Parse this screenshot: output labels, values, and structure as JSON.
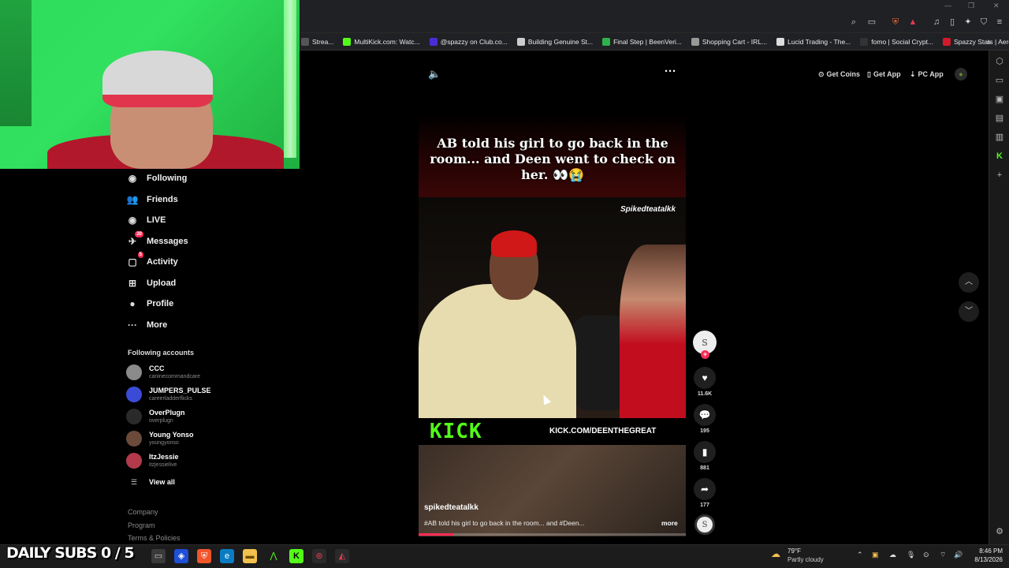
{
  "browser": {
    "bookmarks": [
      {
        "label": "Strea...",
        "icon": "stream-favicon",
        "color": "#555555"
      },
      {
        "label": "MultiKick.com: Watc...",
        "icon": "kick-favicon",
        "color": "#53fc18"
      },
      {
        "label": "@spazzy on Club.co...",
        "icon": "club-favicon",
        "color": "#4b2bd6"
      },
      {
        "label": "Building Genuine St...",
        "icon": "doc-favicon",
        "color": "#cccccc"
      },
      {
        "label": "Final Step | BeenVeri...",
        "icon": "beenverified-favicon",
        "color": "#2fb14b"
      },
      {
        "label": "Shopping Cart - IRL...",
        "icon": "globe-favicon",
        "color": "#999999"
      },
      {
        "label": "Lucid Trading - The...",
        "icon": "lucid-favicon",
        "color": "#dddddd"
      },
      {
        "label": "fomo | Social Crypt...",
        "icon": "fomo-favicon",
        "color": "#333333"
      },
      {
        "label": "Spazzy Stats | AeroK...",
        "icon": "aerok-favicon",
        "color": "#d11a2a"
      }
    ],
    "more_bookmarks": "»"
  },
  "sidebar": {
    "nav": [
      {
        "label": "Following",
        "icon": "following-avatar-icon"
      },
      {
        "label": "Friends",
        "icon": "friends-icon"
      },
      {
        "label": "LIVE",
        "icon": "live-icon"
      },
      {
        "label": "Messages",
        "icon": "messages-icon",
        "badge": "20"
      },
      {
        "label": "Activity",
        "icon": "activity-icon",
        "badge": "5"
      },
      {
        "label": "Upload",
        "icon": "upload-icon"
      },
      {
        "label": "Profile",
        "icon": "profile-avatar-icon"
      },
      {
        "label": "More",
        "icon": "more-dots-icon"
      }
    ],
    "following_title": "Following accounts",
    "accounts": [
      {
        "name": "CCC",
        "handle": "caninecommandcare"
      },
      {
        "name": "JUMPERS_PULSE",
        "handle": "careerladderflicks"
      },
      {
        "name": "OverPlugn",
        "handle": "overplugn"
      },
      {
        "name": "Young Yonso",
        "handle": "youngyonso"
      },
      {
        "name": "ItzJessie",
        "handle": "itzjessielive"
      }
    ],
    "view_all": "View all",
    "footer": [
      "Company",
      "Program",
      "Terms & Policies"
    ]
  },
  "topbar": {
    "get_coins": "Get Coins",
    "get_app": "Get App",
    "pc_app": "PC App"
  },
  "video": {
    "caption": "AB told his girl to go back in the room... and Deen went to check on her. 👀😭",
    "watermark": "Spikedteatalkk",
    "kick_logo": "KICK",
    "kick_url": "KICK.COM/DEENTHEGREAT",
    "author": "spikedteatalkk",
    "description": "#AB told his girl to go back in the room... and #Deen...",
    "more": "more",
    "progress": 0.13
  },
  "actions": {
    "likes": "11.6K",
    "comments": "195",
    "saves": "881",
    "shares": "177"
  },
  "overlay": {
    "daily_subs": "DAILY SUBS 0 / 5"
  },
  "taskbar": {
    "temp": "79°F",
    "weather": "Partly cloudy",
    "time": "8:46 PM",
    "date": "8/13/2026"
  },
  "colors": {
    "accent": "#fe2c55",
    "kick_green": "#53fc18"
  }
}
